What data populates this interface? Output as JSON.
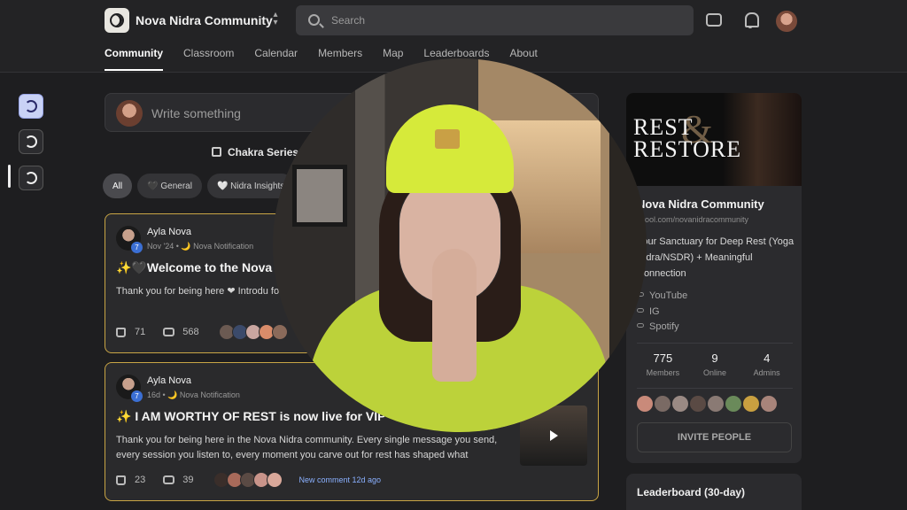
{
  "header": {
    "community_name": "Nova Nidra Community",
    "search_placeholder": "Search"
  },
  "tabs": [
    {
      "label": "Community",
      "active": true
    },
    {
      "label": "Classroom"
    },
    {
      "label": "Calendar"
    },
    {
      "label": "Members"
    },
    {
      "label": "Map"
    },
    {
      "label": "Leaderboards"
    },
    {
      "label": "About"
    }
  ],
  "composer": {
    "placeholder": "Write something"
  },
  "event_banner": "Chakra Series O",
  "filters": [
    "All",
    "🖤 General",
    "🤍 Nidra Insights"
  ],
  "posts": [
    {
      "author": "Ayla Nova",
      "level": "7",
      "meta": "Nov '24 • 🌙 Nova Notification",
      "title": "✨🖤Welcome to the Nova N",
      "body": "Thank you for being here ❤ Introdu following: ✓ Your preferred name ✓ Y",
      "likes": "71",
      "comments": "568"
    },
    {
      "author": "Ayla Nova",
      "level": "7",
      "meta": "16d • 🌙 Nova Notification",
      "title": "✨ I AM WORTHY OF REST is now live for VIP",
      "body": "Thank you for being here in the Nova Nidra community. Every single message you send, every session you listen to, every moment you carve out for rest has shaped what",
      "likes": "23",
      "comments": "39",
      "new_comment": "New comment 12d ago"
    }
  ],
  "sidebar": {
    "banner_text": "REST RESTORE",
    "banner_amp": "&",
    "name": "Nova Nidra Community",
    "url": "skool.com/novanidracommunity",
    "description": "Your Sanctuary for Deep Rest (Yoga Nidra/NSDR) + Meaningful Connection",
    "links": [
      "YouTube",
      "IG",
      "Spotify"
    ],
    "stats": [
      {
        "value": "775",
        "label": "Members"
      },
      {
        "value": "9",
        "label": "Online"
      },
      {
        "value": "4",
        "label": "Admins"
      }
    ],
    "invite_label": "INVITE PEOPLE"
  },
  "leaderboard": {
    "title": "Leaderboard (30-day)"
  },
  "colors": {
    "accent_gold": "#c9a545",
    "link_blue": "#8ab0ff",
    "beanie": "#d6ea3a"
  }
}
